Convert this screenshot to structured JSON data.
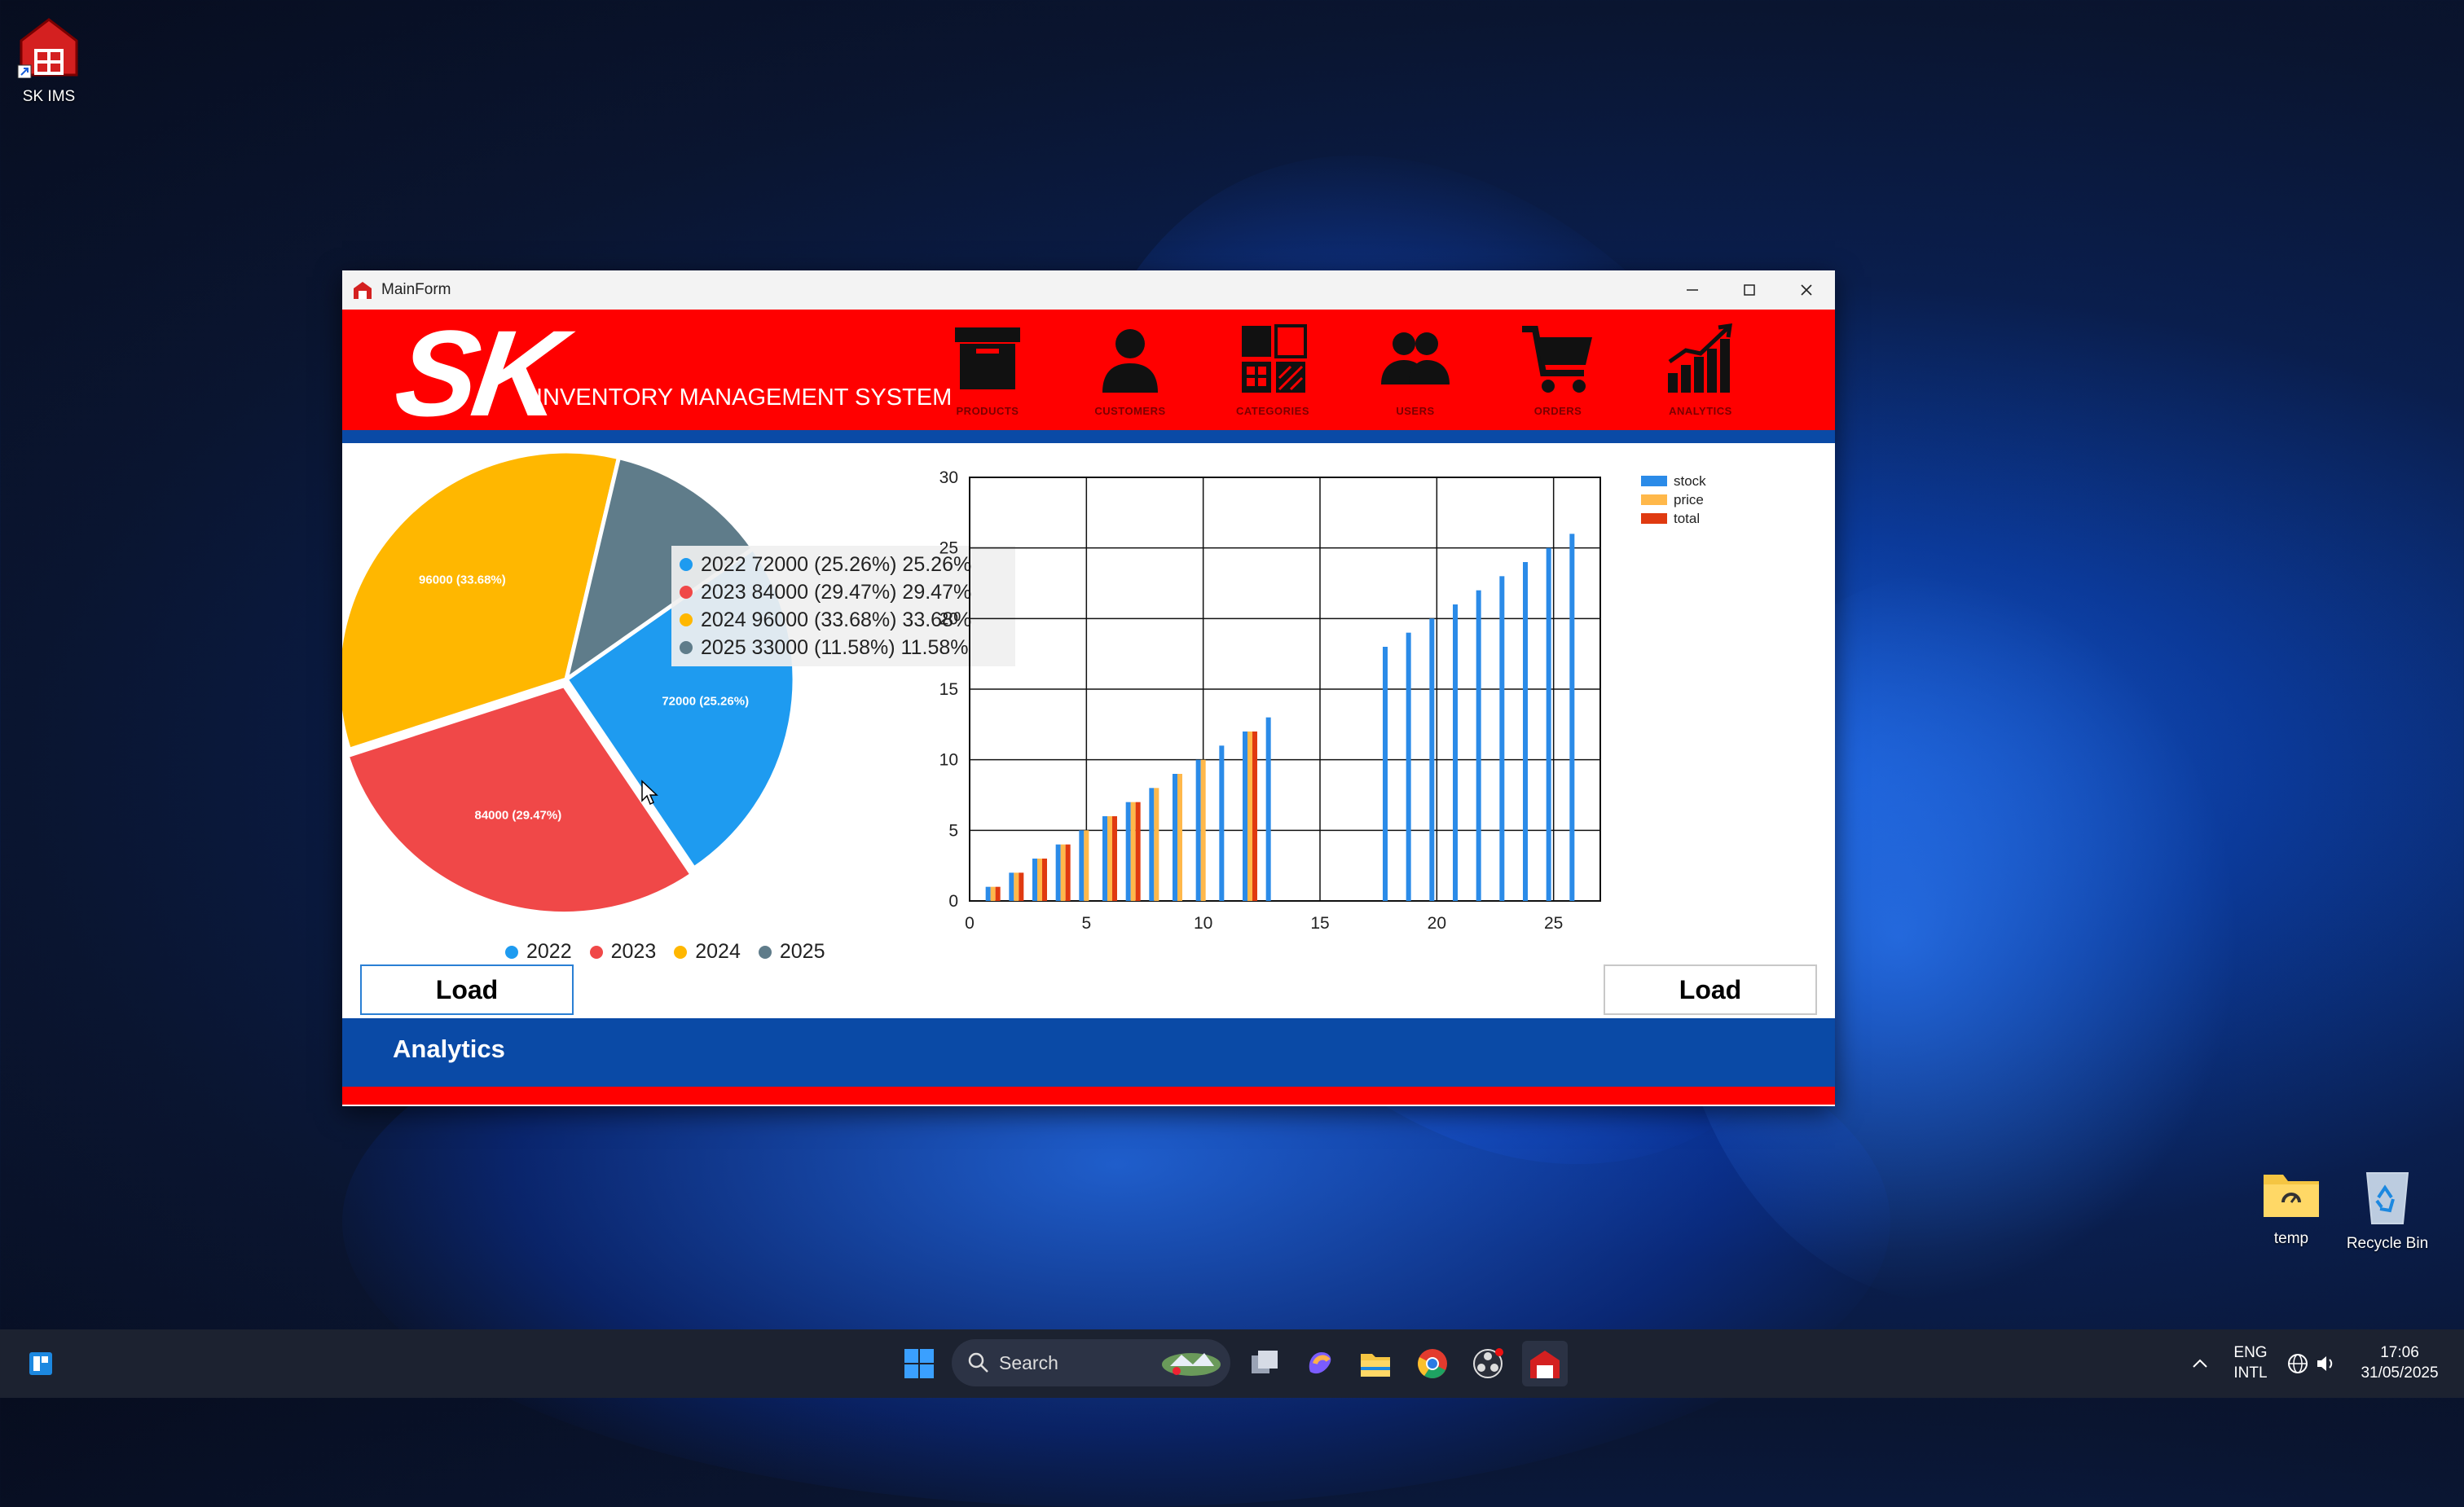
{
  "desktop": {
    "icons": [
      {
        "label": "SK IMS"
      },
      {
        "label": "temp"
      },
      {
        "label": "Recycle Bin"
      }
    ]
  },
  "window": {
    "title": "MainForm",
    "brand": "SK",
    "subtitle": "INVENTORY MANAGEMENT SYSTEM",
    "nav": [
      {
        "label": "PRODUCTS",
        "icon": "box-icon"
      },
      {
        "label": "CUSTOMERS",
        "icon": "person-icon"
      },
      {
        "label": "CATEGORIES",
        "icon": "categories-icon"
      },
      {
        "label": "USERS",
        "icon": "users-icon"
      },
      {
        "label": "ORDERS",
        "icon": "cart-icon"
      },
      {
        "label": "ANALYTICS",
        "icon": "analytics-icon"
      }
    ],
    "colors": {
      "header": "#ff0000",
      "band": "#0a4aa6"
    },
    "left_load": "Load",
    "right_load": "Load",
    "footer_title": "Analytics"
  },
  "chart_data": [
    {
      "type": "pie",
      "slices": [
        {
          "label": "2022",
          "value": 72000,
          "percent": 25.26,
          "color": "#1e9bf0",
          "data_label": "72000 (25.26%)",
          "tip": "2022 72000 (25.26%) 25.26%"
        },
        {
          "label": "2023",
          "value": 84000,
          "percent": 29.47,
          "color": "#f04848",
          "data_label": "84000 (29.47%)",
          "tip": "2023 84000 (29.47%) 29.47%"
        },
        {
          "label": "2024",
          "value": 96000,
          "percent": 33.68,
          "color": "#ffb700",
          "data_label": "96000 (33.68%)",
          "tip": "2024 96000 (33.68%) 33.68%"
        },
        {
          "label": "2025",
          "value": 33000,
          "percent": 11.58,
          "color": "#5f7c8a",
          "data_label": "",
          "tip": "2025 33000 (11.58%) 11.58%"
        }
      ],
      "legend": "bottom"
    },
    {
      "type": "bar",
      "xlim": [
        0,
        27
      ],
      "ylim": [
        0,
        30
      ],
      "xticks": [
        0,
        5,
        10,
        15,
        20,
        25
      ],
      "yticks": [
        0,
        5,
        10,
        15,
        20,
        25,
        30
      ],
      "grid": true,
      "legend": "top-right",
      "series": [
        {
          "name": "stock",
          "color": "#2b8be8",
          "points": [
            [
              1,
              1
            ],
            [
              2,
              2
            ],
            [
              3,
              3
            ],
            [
              4,
              4
            ],
            [
              5,
              5
            ],
            [
              6,
              6
            ],
            [
              7,
              7
            ],
            [
              8,
              8
            ],
            [
              9,
              9
            ],
            [
              10,
              10
            ],
            [
              11,
              11
            ],
            [
              12,
              12
            ],
            [
              13,
              13
            ],
            [
              18,
              18
            ],
            [
              19,
              19
            ],
            [
              20,
              20
            ],
            [
              21,
              21
            ],
            [
              22,
              22
            ],
            [
              23,
              23
            ],
            [
              24,
              24
            ],
            [
              25,
              25
            ],
            [
              26,
              26
            ]
          ]
        },
        {
          "name": "price",
          "color": "#ffb84a",
          "points": [
            [
              1,
              1
            ],
            [
              2,
              2
            ],
            [
              3,
              3
            ],
            [
              4,
              4
            ],
            [
              5,
              5
            ],
            [
              6,
              6
            ],
            [
              7,
              7
            ],
            [
              8,
              8
            ],
            [
              9,
              9
            ],
            [
              10,
              10
            ],
            [
              12,
              12
            ]
          ]
        },
        {
          "name": "total",
          "color": "#e03a10",
          "points": [
            [
              1,
              1
            ],
            [
              2,
              2
            ],
            [
              3,
              3
            ],
            [
              4,
              4
            ],
            [
              6,
              6
            ],
            [
              7,
              7
            ],
            [
              12,
              12
            ]
          ]
        }
      ]
    }
  ],
  "taskbar": {
    "search_placeholder": "Search",
    "lang_top": "ENG",
    "lang_bottom": "INTL",
    "time": "17:06",
    "date": "31/05/2025"
  }
}
